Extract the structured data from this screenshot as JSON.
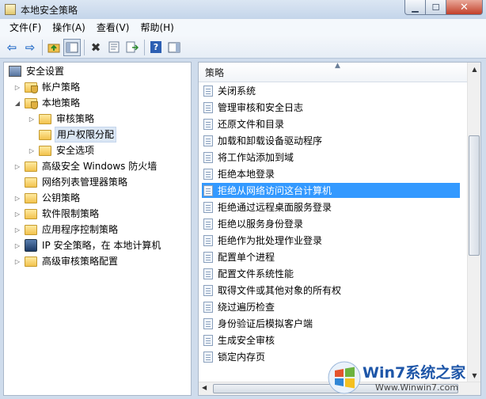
{
  "window": {
    "title": "本地安全策略"
  },
  "menu": [
    "文件(F)",
    "操作(A)",
    "查看(V)",
    "帮助(H)"
  ],
  "toolbar": {
    "back_glyph": "⇦",
    "forward_glyph": "⇨",
    "delete_glyph": "✖",
    "help_glyph": "?"
  },
  "tree": {
    "items": [
      {
        "label": "安全设置",
        "icon": "computer-icon"
      },
      {
        "label": "帐户策略",
        "icon": "folder-icon"
      },
      {
        "label": "本地策略",
        "icon": "folder-icon"
      },
      {
        "label": "审核策略",
        "icon": "folder-icon"
      },
      {
        "label": "用户权限分配",
        "icon": "folder-icon",
        "selected": true
      },
      {
        "label": "安全选项",
        "icon": "folder-icon"
      },
      {
        "label": "高级安全 Windows 防火墙",
        "icon": "folder-icon"
      },
      {
        "label": "网络列表管理器策略",
        "icon": "folder-icon"
      },
      {
        "label": "公钥策略",
        "icon": "folder-icon"
      },
      {
        "label": "软件限制策略",
        "icon": "folder-icon"
      },
      {
        "label": "应用程序控制策略",
        "icon": "folder-icon"
      },
      {
        "label": "IP 安全策略，在 本地计算机",
        "icon": "ipsec-icon"
      },
      {
        "label": "高级审核策略配置",
        "icon": "folder-icon"
      }
    ]
  },
  "list": {
    "header": "策略",
    "items": [
      "关闭系统",
      "管理审核和安全日志",
      "还原文件和目录",
      "加载和卸载设备驱动程序",
      "将工作站添加到域",
      "拒绝本地登录",
      "拒绝从网络访问这台计算机",
      "拒绝通过远程桌面服务登录",
      "拒绝以服务身份登录",
      "拒绝作为批处理作业登录",
      "配置单个进程",
      "配置文件系统性能",
      "取得文件或其他对象的所有权",
      "绕过遍历检查",
      "身份验证后模拟客户端",
      "生成安全审核",
      "锁定内存页"
    ],
    "selected_item": "拒绝从网络访问这台计算机"
  },
  "watermark": {
    "brand": "Win7系统之家",
    "url": "Www.Winwin7.com"
  },
  "colors": {
    "selection": "#3399ff",
    "folder": "#f2c24d",
    "brand": "#1e56a8"
  }
}
